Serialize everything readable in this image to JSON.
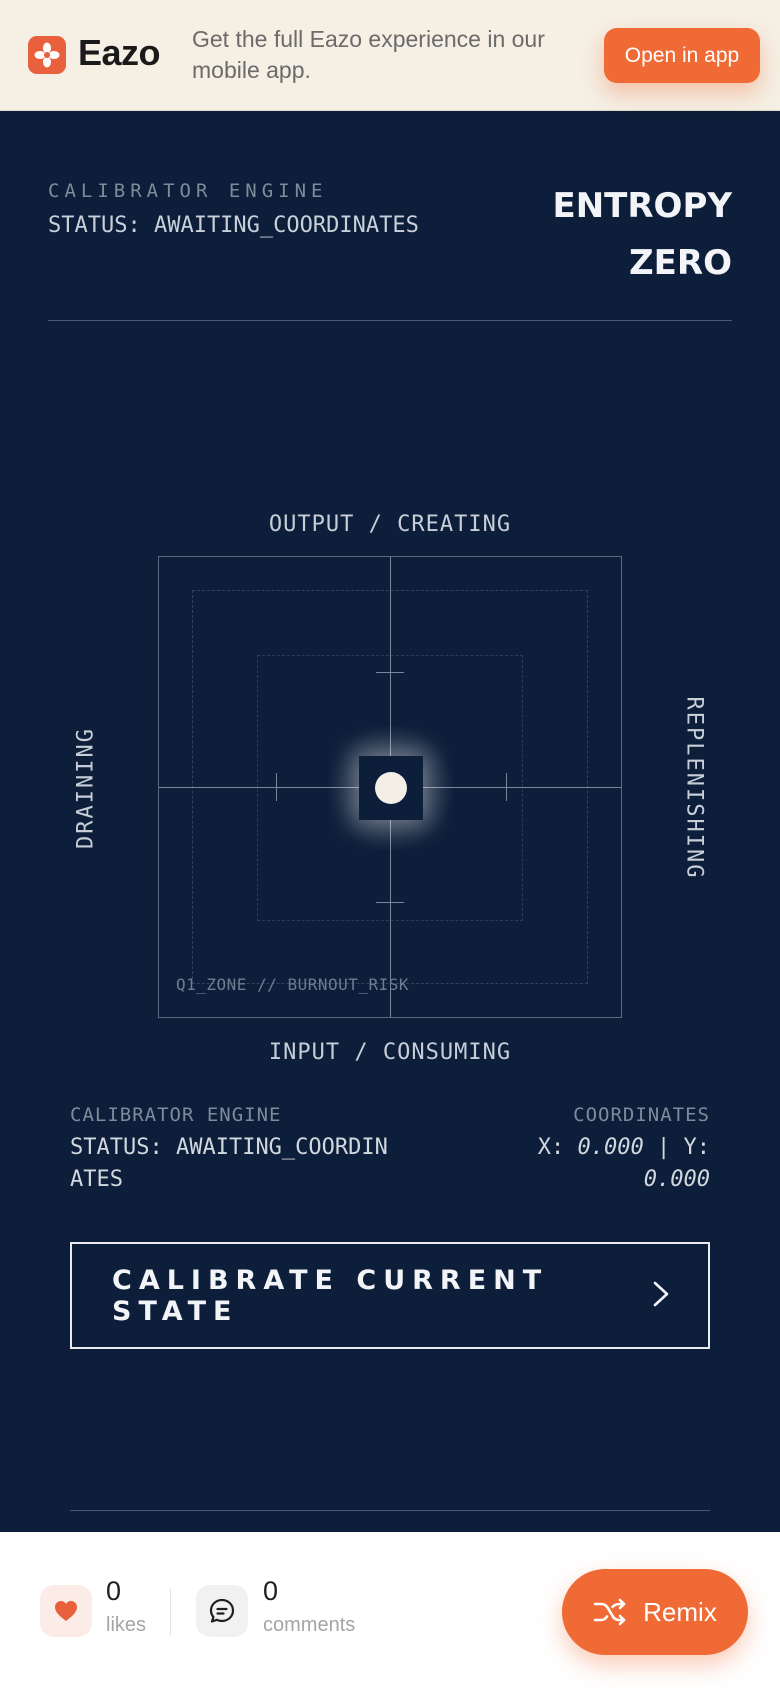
{
  "banner": {
    "brand": "Eazo",
    "message": "Get the full Eazo experience in our mobile app.",
    "open_label": "Open in app",
    "accent": "#f06a35"
  },
  "header": {
    "eyebrow": "CALIBRATOR ENGINE",
    "status": "STATUS: AWAITING_COORDINATES",
    "title": "ENTROPY ZERO"
  },
  "grid": {
    "axis_top": "OUTPUT / CREATING",
    "axis_bottom": "INPUT / CONSUMING",
    "axis_left": "DRAINING",
    "axis_right": "REPLENISHING",
    "zone_label": "Q1_ZONE // BURNOUT_RISK"
  },
  "readout": {
    "engine_label": "CALIBRATOR ENGINE",
    "status_label": "STATUS:",
    "status_value": "AWAITING_COORDINATES",
    "coords_label": "COORDINATES",
    "x_prefix": "X:",
    "x_value": "0.000",
    "y_prefix": "| Y:",
    "y_value": "0.000"
  },
  "cta": {
    "label": "CALIBRATE CURRENT STATE"
  },
  "footer": {
    "likes_count": "0",
    "likes_label": "likes",
    "comments_count": "0",
    "comments_label": "comments",
    "remix_label": "Remix"
  },
  "colors": {
    "background": "#0c1e39",
    "accent": "#f06a35",
    "banner_bg": "#f5efe4"
  }
}
